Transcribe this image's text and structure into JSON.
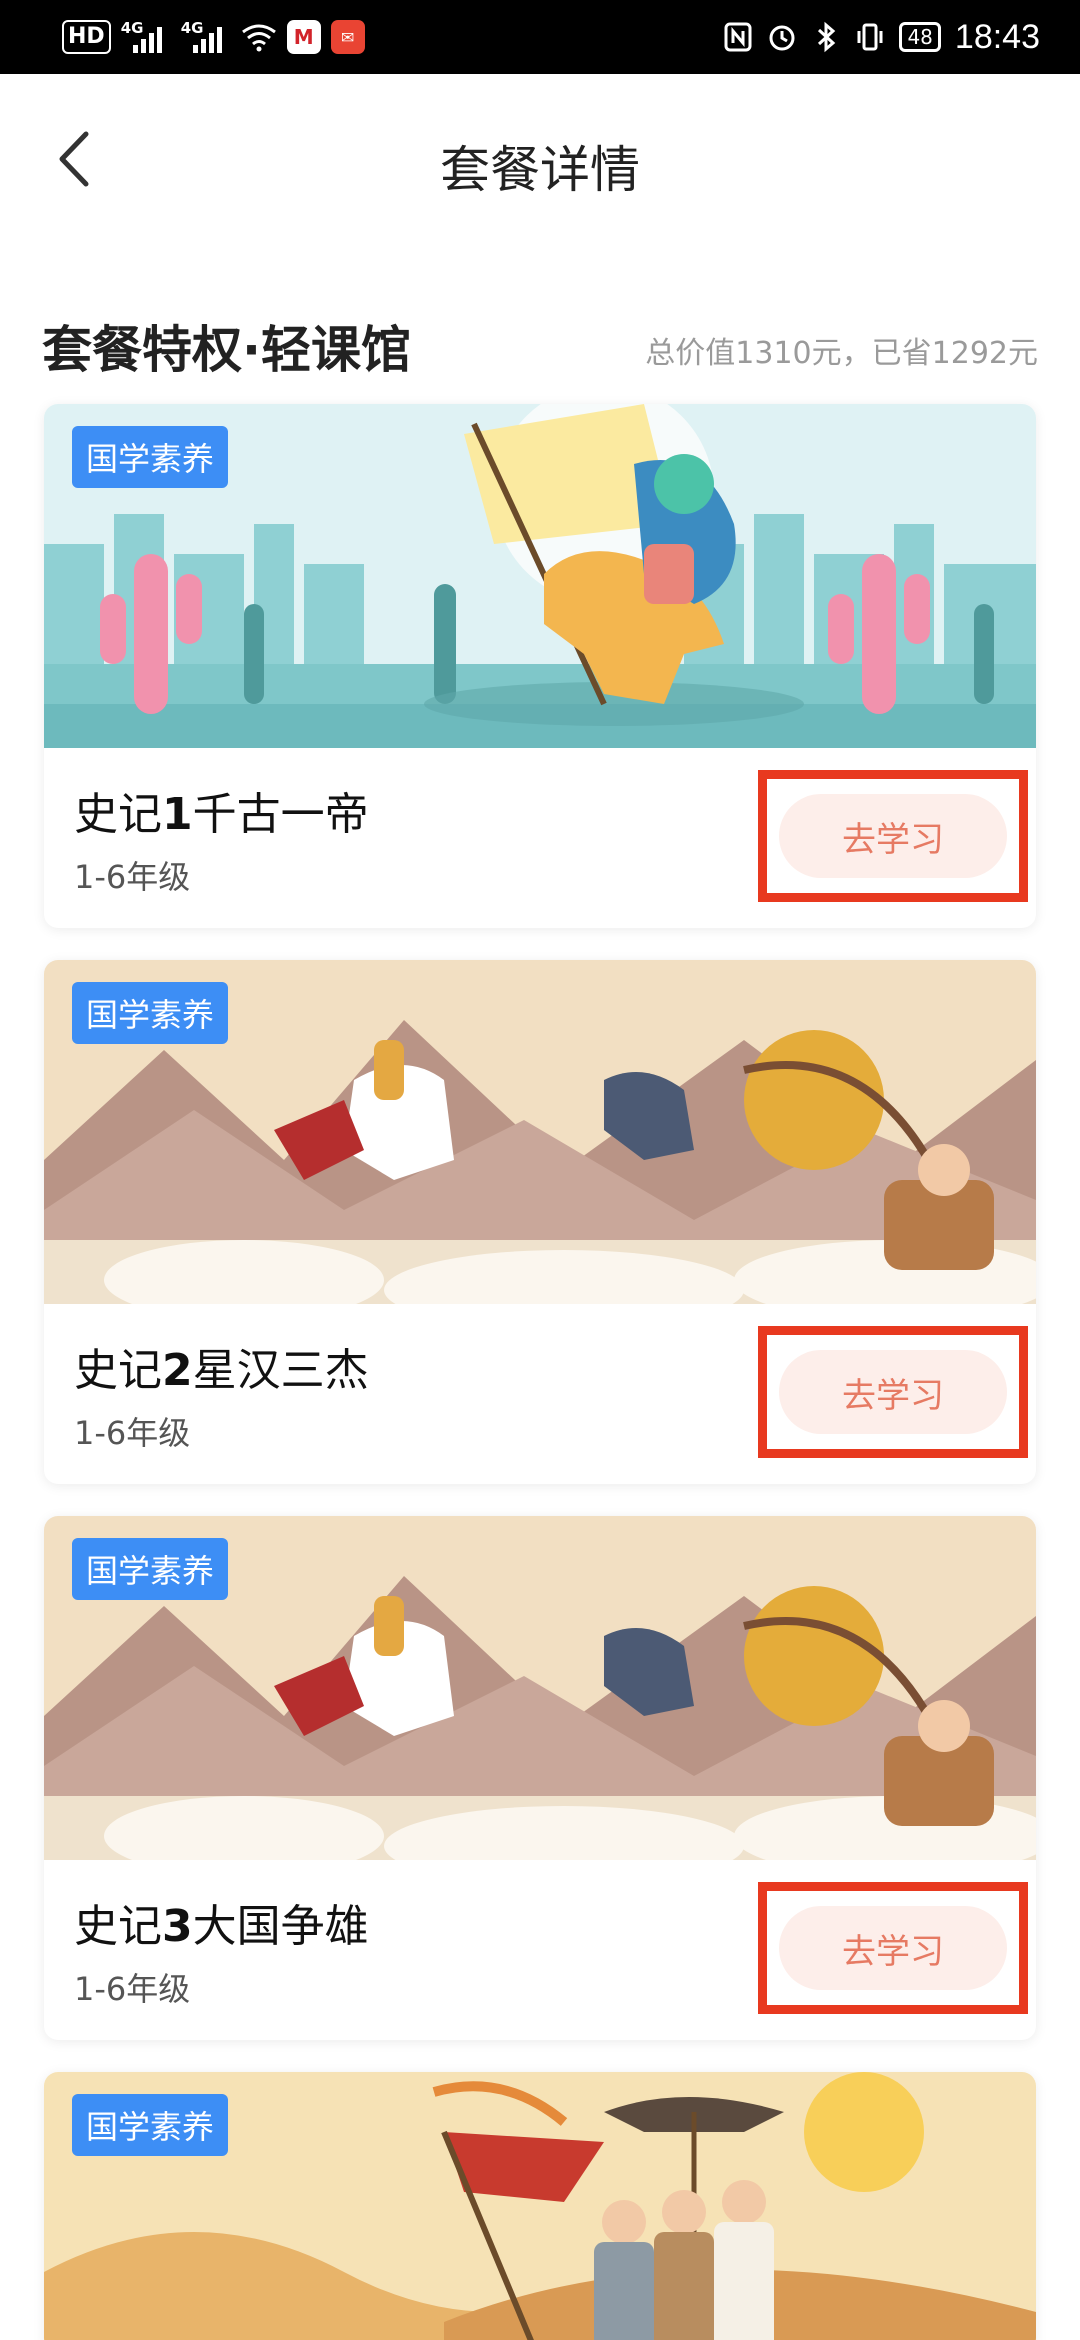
{
  "status_bar": {
    "hd": "HD",
    "signal1": "4G",
    "signal2": "4G",
    "battery": "48",
    "time": "18:43"
  },
  "header": {
    "title": "套餐详情",
    "back_icon": "chevron-left-icon"
  },
  "section": {
    "title": "套餐特权·轻课馆",
    "meta": "总价值1310元，已省1292元"
  },
  "courses": [
    {
      "tag": "国学素养",
      "title_pre": "史记",
      "title_num": "1",
      "title_post": "千古一帝",
      "grade": "1-6年级",
      "button": "去学习"
    },
    {
      "tag": "国学素养",
      "title_pre": "史记",
      "title_num": "2",
      "title_post": "星汉三杰",
      "grade": "1-6年级",
      "button": "去学习"
    },
    {
      "tag": "国学素养",
      "title_pre": "史记",
      "title_num": "3",
      "title_post": "大国争雄",
      "grade": "1-6年级",
      "button": "去学习"
    },
    {
      "tag": "国学素养"
    }
  ],
  "colors": {
    "tag_bg": "#3d8ef5",
    "button_bg": "#fdeeea",
    "button_text": "#e67a63",
    "highlight_box": "#e8391f"
  }
}
